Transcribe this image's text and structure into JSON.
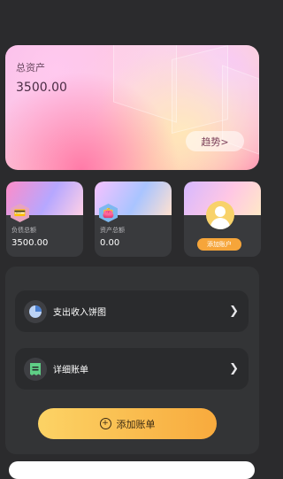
{
  "hero": {
    "label": "总资产",
    "value": "3500.00",
    "trend_label": "趋势>"
  },
  "cards": [
    {
      "label": "负债总额",
      "value": "3500.00",
      "icon": "debt-icon"
    },
    {
      "label": "资产总额",
      "value": "0.00",
      "icon": "asset-icon"
    },
    {
      "add_label": "添加账户",
      "icon": "add-user-icon"
    }
  ],
  "menu": [
    {
      "label": "支出收入饼图",
      "icon": "pie-chart-icon"
    },
    {
      "label": "详细账单",
      "icon": "receipt-icon"
    }
  ],
  "add_bill_label": "添加账单",
  "colors": {
    "background": "#2b2b2d",
    "panel": "#333436",
    "accent_orange": "#f6a53a",
    "accent_yellow": "#fcd365"
  }
}
